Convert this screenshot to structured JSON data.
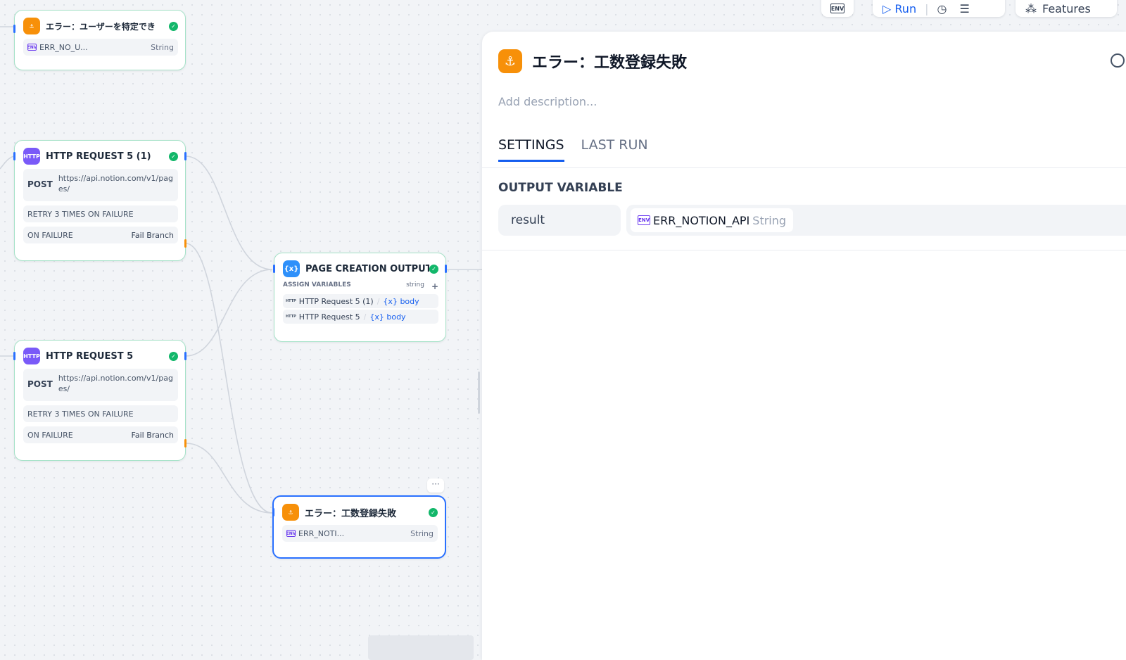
{
  "toolbar": {
    "env_label": "ENV",
    "run_label": "Run",
    "features_label": "Features"
  },
  "nodes": {
    "err_user": {
      "title": "エラー：ユーザーを特定でき",
      "var": "ERR_NO_U...",
      "type": "String"
    },
    "http1": {
      "title": "HTTP REQUEST 5 (1)",
      "method": "POST",
      "url": "https://api.notion.com/v1/pages/",
      "retry": "RETRY 3 TIMES ON FAILURE",
      "failure_label": "ON FAILURE",
      "failure_value": "Fail Branch"
    },
    "http2": {
      "title": "HTTP REQUEST 5",
      "method": "POST",
      "url": "https://api.notion.com/v1/pages/",
      "retry": "RETRY 3 TIMES ON FAILURE",
      "failure_label": "ON FAILURE",
      "failure_value": "Fail Branch"
    },
    "page_output": {
      "icon": "{x}",
      "title": "PAGE CREATION OUTPUT",
      "assign_label": "ASSIGN VARIABLES",
      "assign_type": "string",
      "add_label": "+",
      "items": [
        {
          "source": "HTTP Request 5 (1)",
          "var": "body"
        },
        {
          "source": "HTTP Request 5",
          "var": "body"
        }
      ]
    },
    "err_koushu": {
      "title": "エラー：工数登録失敗",
      "var": "ERR_NOTI...",
      "type": "String",
      "more": "···"
    }
  },
  "panel": {
    "title": "エラー：工数登録失敗",
    "description_placeholder": "Add description...",
    "tabs": [
      "SETTINGS",
      "LAST RUN"
    ],
    "section_label": "OUTPUT VARIABLE",
    "output_name": "result",
    "output_var": "ERR_NOTION_API",
    "output_type": "String"
  },
  "icons": {
    "answer": "answer-node-icon",
    "http": "http-node-icon",
    "assigner": "variable-assigner-icon",
    "env": "env-icon",
    "check": "check-circle-icon",
    "locate": "locate-icon",
    "play": "play-icon"
  },
  "colors": {
    "accent": "#155eef",
    "success": "#12b76a",
    "answer_node": "#f79009",
    "http_node": "#7a5af8",
    "assigner_node": "#2e90fa"
  }
}
